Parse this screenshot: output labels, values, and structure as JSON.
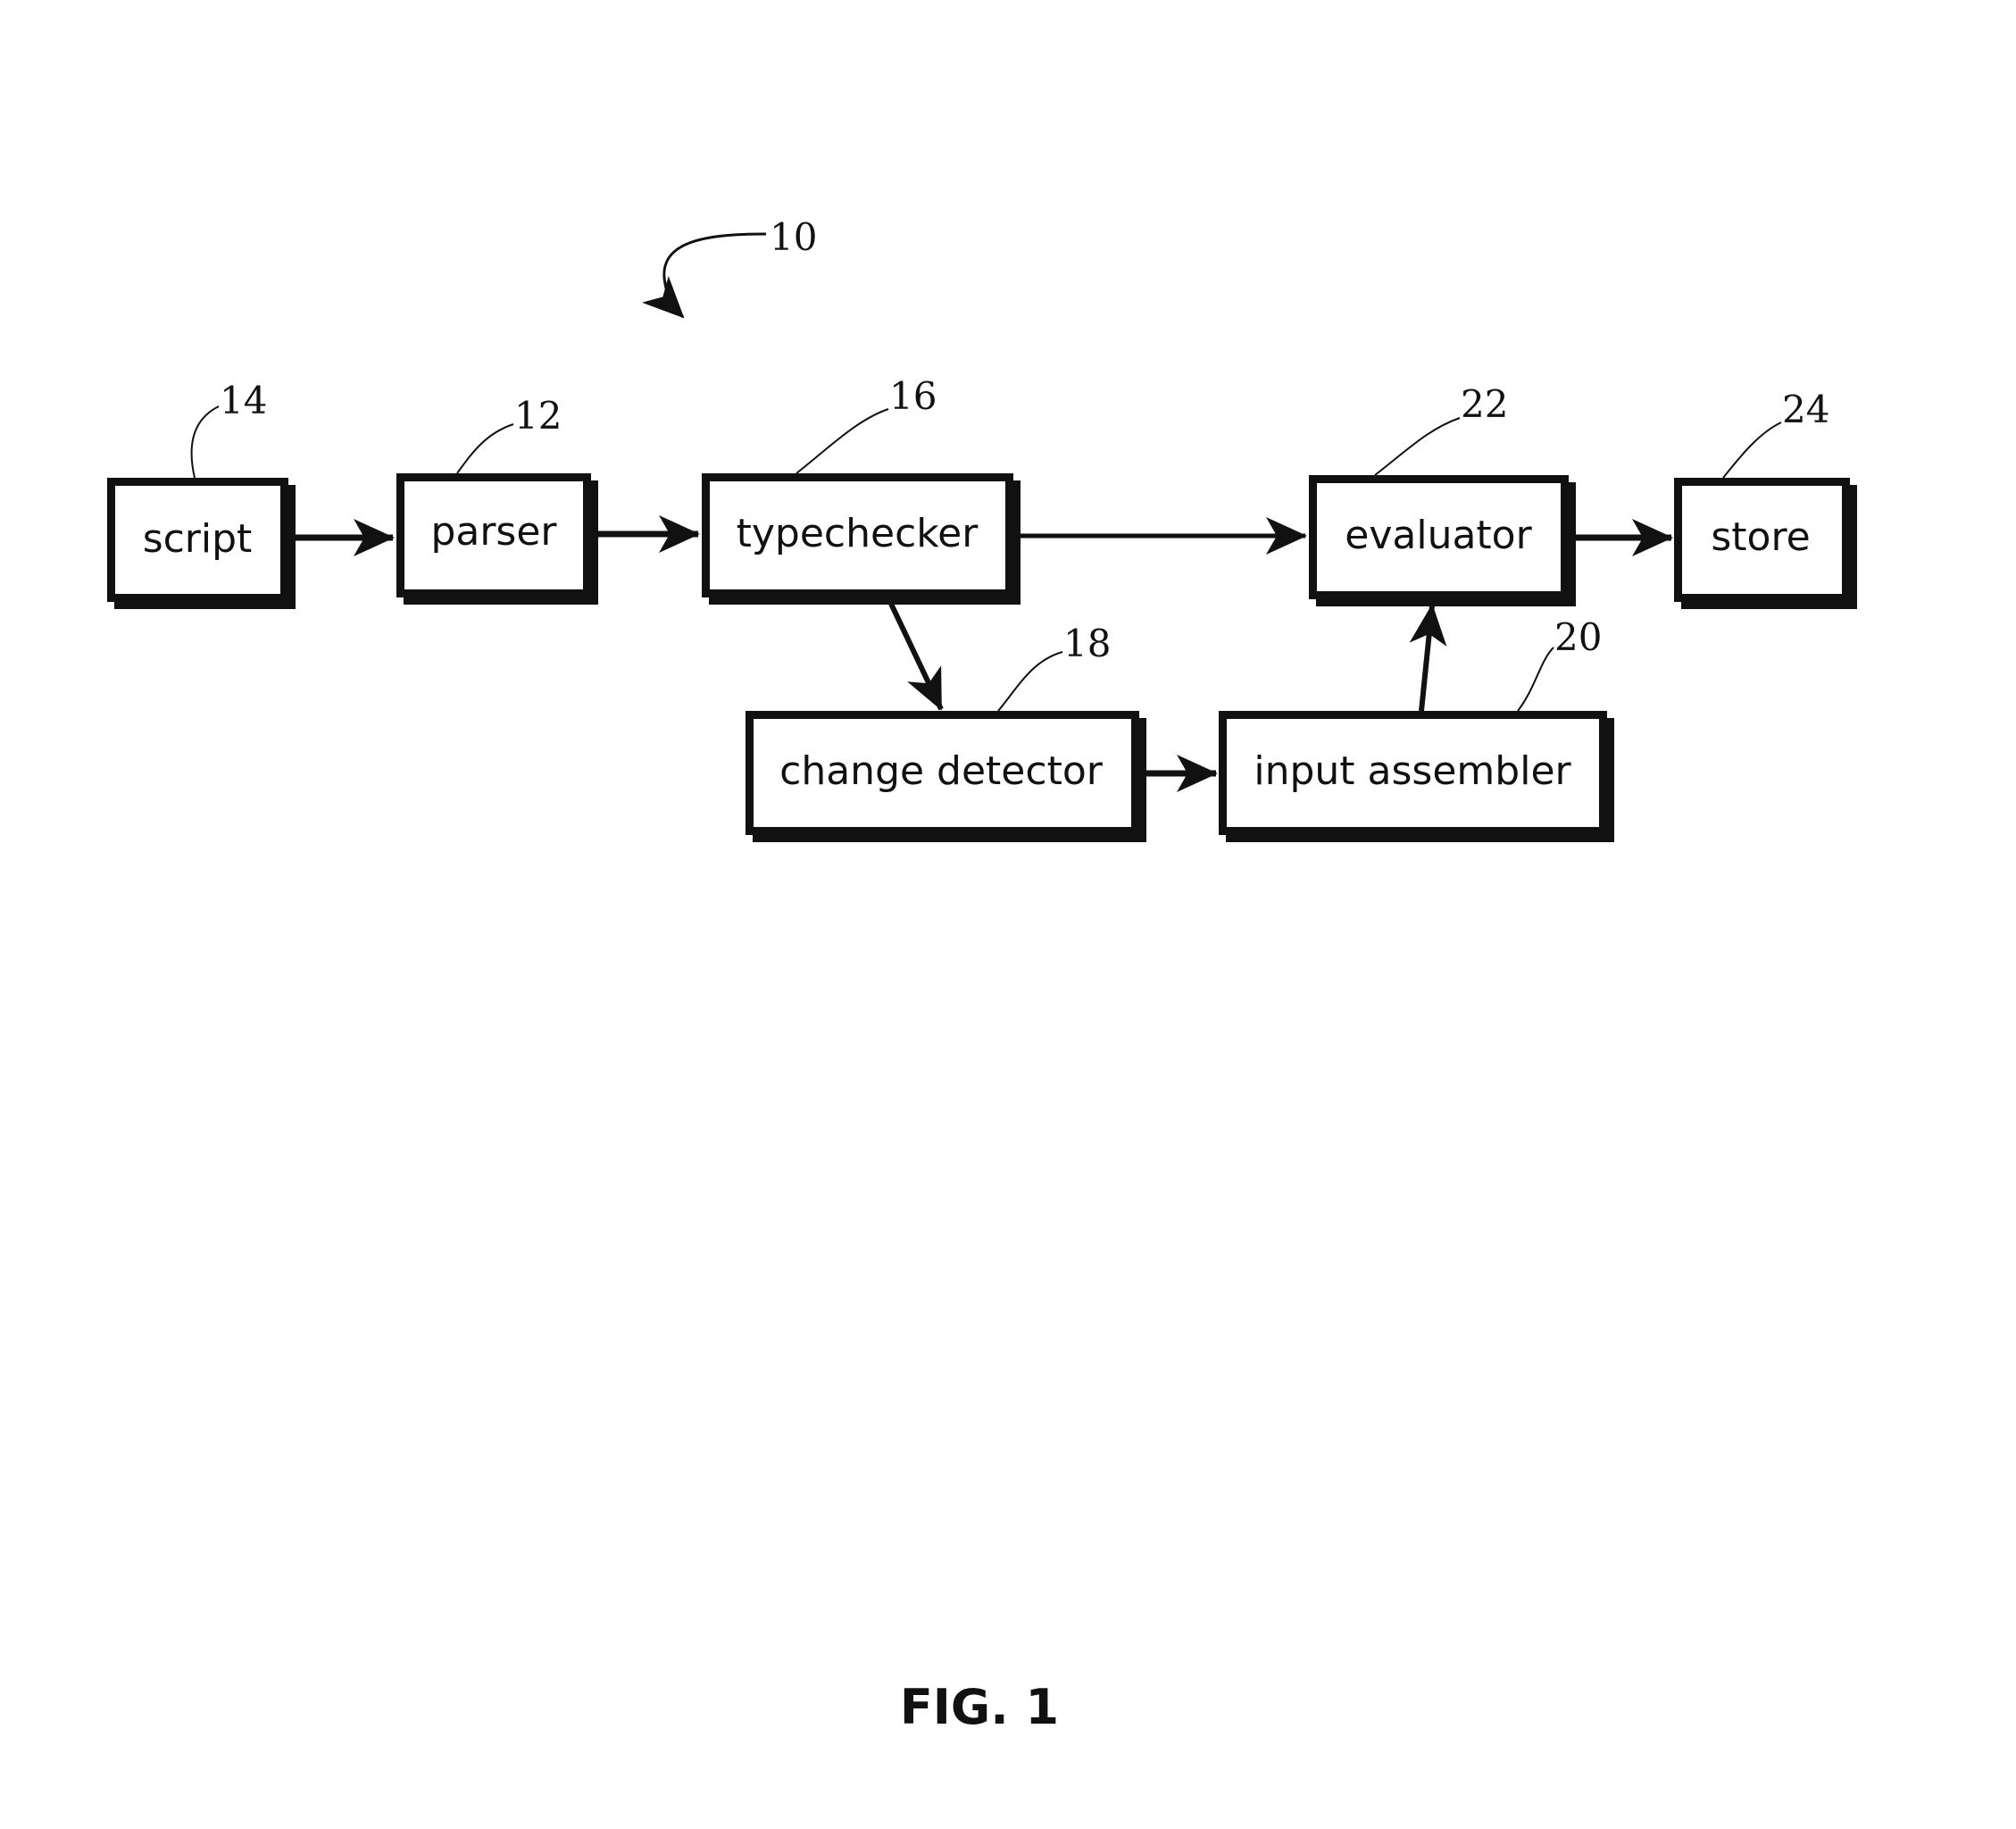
{
  "figure": {
    "title": "FIG. 1",
    "system_ref": "10"
  },
  "blocks": {
    "script": {
      "label": "script",
      "ref": "14"
    },
    "parser": {
      "label": "parser",
      "ref": "12"
    },
    "typechecker": {
      "label": "typechecker",
      "ref": "16"
    },
    "evaluator": {
      "label": "evaluator",
      "ref": "22"
    },
    "store": {
      "label": "store",
      "ref": "24"
    },
    "change_detector": {
      "label": "change detector",
      "ref": "18"
    },
    "input_assembler": {
      "label": "input assembler",
      "ref": "20"
    }
  },
  "connections": [
    {
      "from": "script",
      "to": "parser"
    },
    {
      "from": "parser",
      "to": "typechecker"
    },
    {
      "from": "typechecker",
      "to": "evaluator"
    },
    {
      "from": "evaluator",
      "to": "store"
    },
    {
      "from": "typechecker",
      "to": "change_detector"
    },
    {
      "from": "change_detector",
      "to": "input_assembler"
    },
    {
      "from": "input_assembler",
      "to": "evaluator"
    }
  ]
}
